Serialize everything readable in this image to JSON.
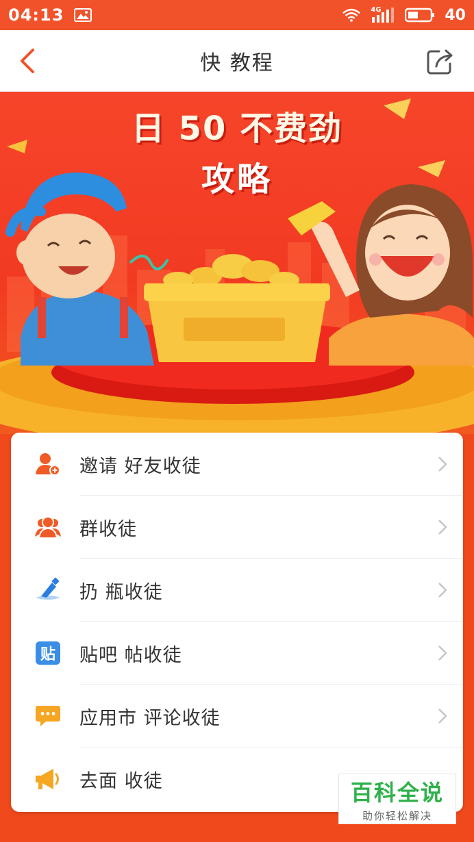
{
  "status_bar": {
    "time": "04:13",
    "network": "4G",
    "battery": "40",
    "icons": [
      "image-icon",
      "wifi-icon",
      "signal-icon",
      "battery-icon"
    ]
  },
  "header": {
    "title": "快  教程",
    "back_icon": "back-chevron-icon",
    "share_icon": "share-icon",
    "accent": "#f2522a"
  },
  "banner": {
    "headline_1": "日 50 不费劲",
    "headline_2": "攻略",
    "basket_label": ""
  },
  "menu": {
    "items": [
      {
        "label": "邀请  好友收徒",
        "icon": "add-user-icon",
        "color": "#f05a24"
      },
      {
        "label": "  群收徒",
        "icon": "group-icon",
        "color": "#f05a24"
      },
      {
        "label": "扔  瓶收徒",
        "icon": "bottle-icon",
        "color": "#2a7de1"
      },
      {
        "label": "贴吧  帖收徒",
        "icon": "tieba-icon",
        "color": "#3a8ee6",
        "icon_text": "贴"
      },
      {
        "label": "应用市  评论收徒",
        "icon": "comment-icon",
        "color": "#f5a623"
      },
      {
        "label": "去面  收徒",
        "icon": "megaphone-icon",
        "color": "#f5a623"
      }
    ]
  },
  "watermark": {
    "main": "百科全说",
    "sub": "助你轻松解决"
  }
}
